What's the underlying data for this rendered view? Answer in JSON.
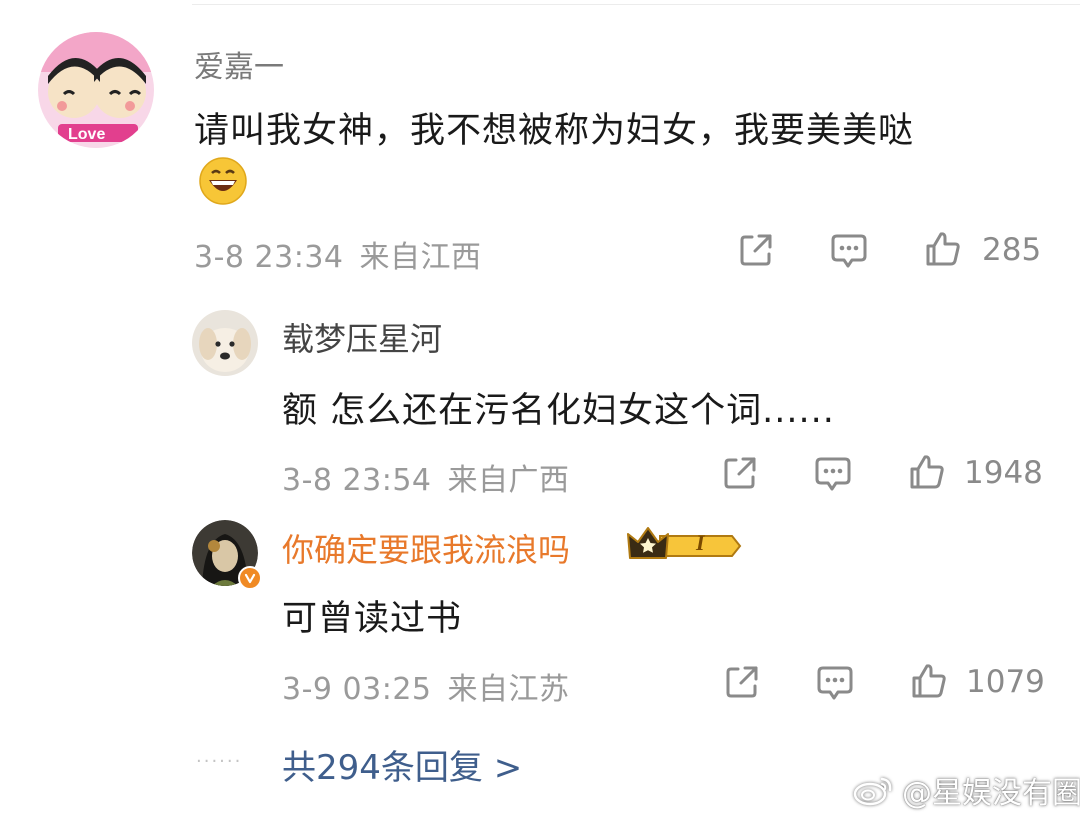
{
  "comments": [
    {
      "username": "爱嘉一",
      "text_line1": "请叫我女神，我不想被称为妇女，我要美美哒",
      "emoji": "grinning-emoji",
      "timestamp": "3-8 23:34",
      "location": "来自江西",
      "likes": "285"
    },
    {
      "username": "载梦压星河",
      "text": "额 怎么还在污名化妇女这个词......",
      "timestamp": "3-8 23:54",
      "location": "来自广西",
      "likes": "1948"
    },
    {
      "username": "你确定要跟我流浪吗",
      "badge": "I",
      "text": "可曾读过书",
      "timestamp": "3-9 03:25",
      "location": "来自江苏",
      "likes": "1079"
    }
  ],
  "replies": {
    "dots": "......",
    "label": "共294条回复 >"
  },
  "watermark": {
    "at": "@星娱没有圈"
  },
  "colors": {
    "vip_name": "#e8792b",
    "reply_link": "#3f5e8c",
    "meta_gray": "#9a9a9a",
    "icon_gray": "#8a8a8a"
  }
}
